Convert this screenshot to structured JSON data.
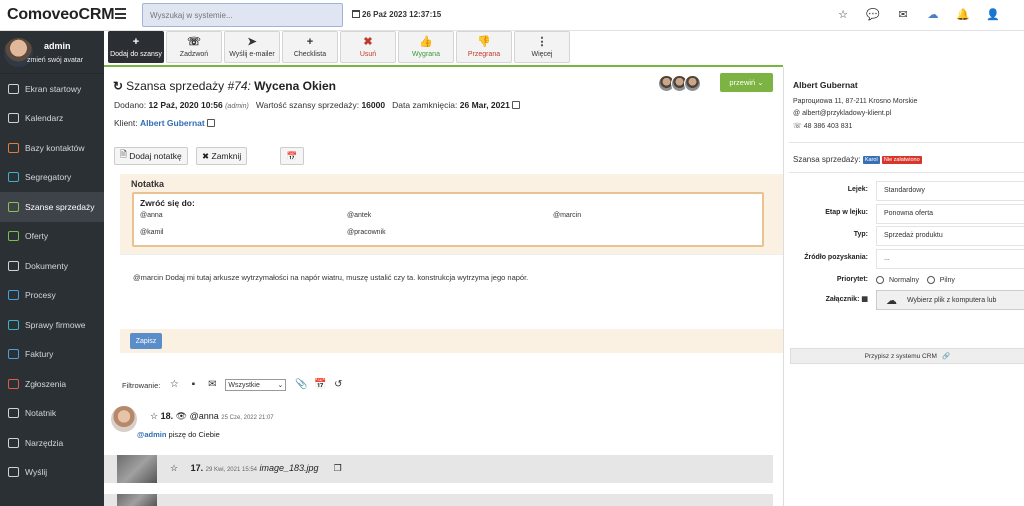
{
  "app": {
    "logo": "ComoveoCRM"
  },
  "header": {
    "search_placeholder": "Wyszukaj w systemie...",
    "datetime": "26 Paź 2023 12:37:15",
    "icons": [
      "star-icon",
      "chat-icon",
      "mail-icon",
      "cloud-icon",
      "bell-icon",
      "user-settings-icon"
    ]
  },
  "user": {
    "name": "admin",
    "change_avatar": "zmień swój avatar"
  },
  "sidebar": {
    "items": [
      {
        "label": "Ekran startowy",
        "icon": "monitor-icon",
        "color": "#cfd3d6"
      },
      {
        "label": "Kalendarz",
        "icon": "calendar-icon",
        "color": "#cfd3d6"
      },
      {
        "label": "Bazy kontaktów",
        "icon": "contacts-icon",
        "color": "#e87b3a"
      },
      {
        "label": "Segregatory",
        "icon": "folder-icon",
        "color": "#3fb0c9"
      },
      {
        "label": "Szanse sprzedaży",
        "icon": "refresh-icon",
        "color": "#8bc34a",
        "active": true
      },
      {
        "label": "Oferty",
        "icon": "offer-icon",
        "color": "#7bbf4b"
      },
      {
        "label": "Dokumenty",
        "icon": "document-icon",
        "color": "#cfd3d6"
      },
      {
        "label": "Procesy",
        "icon": "process-icon",
        "color": "#4a9fd8"
      },
      {
        "label": "Sprawy firmowe",
        "icon": "case-icon",
        "color": "#3fb0c9"
      },
      {
        "label": "Faktury",
        "icon": "invoice-icon",
        "color": "#4a9fd8"
      },
      {
        "label": "Zgłoszenia",
        "icon": "ticket-icon",
        "color": "#e05a47"
      },
      {
        "label": "Notatnik",
        "icon": "notebook-icon",
        "color": "#cfd3d6"
      },
      {
        "label": "Narzędzia",
        "icon": "tools-icon",
        "color": "#cfd3d6"
      },
      {
        "label": "Wyślij",
        "icon": "send-icon",
        "color": "#cfd3d6"
      }
    ]
  },
  "toolbar": [
    {
      "label": "Dodaj do szansy",
      "glyph": "+",
      "style": "primary",
      "icon": "plus-icon"
    },
    {
      "label": "Zadzwoń",
      "glyph": "☏",
      "style": "",
      "icon": "phone-icon"
    },
    {
      "label": "Wyślij e-mailer",
      "glyph": "➤",
      "style": "",
      "icon": "send-icon"
    },
    {
      "label": "Checklista",
      "glyph": "+",
      "style": "",
      "icon": "plus-icon"
    },
    {
      "label": "Usuń",
      "glyph": "✖",
      "style": "danger",
      "icon": "delete-icon"
    },
    {
      "label": "Wygrana",
      "glyph": "👍",
      "style": "success",
      "icon": "thumbs-up-icon"
    },
    {
      "label": "Przegrana",
      "glyph": "👎",
      "style": "danger",
      "icon": "thumbs-down-icon"
    },
    {
      "label": "Więcej",
      "glyph": "⋮",
      "style": "",
      "icon": "more-icon"
    }
  ],
  "deal": {
    "title_prefix": "Szansa sprzedaży",
    "number": "#74:",
    "name": "Wycena Okien",
    "move_button": "przewiń",
    "added_label": "Dodano:",
    "added_value": "12 Paź, 2020 10:56",
    "added_by": "(admin)",
    "value_label": "Wartość szansy sprzedaży:",
    "value": "16000",
    "close_label": "Data zamknięcia:",
    "close_value": "26 Mar, 2021",
    "client_label": "Klient:",
    "client_name": "Albert Gubernat",
    "add_note": "Dodaj notatkę",
    "close_button": "Zamknij"
  },
  "note": {
    "header": "Notatka",
    "mention_label": "Zwróć się do:",
    "mentions": [
      "@anna",
      "@antek",
      "@marcin",
      "@kamil",
      "@pracownik"
    ],
    "text": "@marcin Dodaj mi tutaj arkusze wytrzymałości na napór wiatru, muszę ustalić czy ta. konstrukcja wytrzyma jego napór.",
    "save": "Zapisz"
  },
  "filter": {
    "label": "Filtrowanie:",
    "select_value": "Wszystkie"
  },
  "feed": [
    {
      "number": "18.",
      "user": "@anna",
      "date": "25 Cze, 2022 21:07",
      "body_user": "@admin",
      "body_text": "piszę do Ciebie"
    },
    {
      "number": "17.",
      "date": "29 Kwi, 2021 15:54",
      "file": "image_183.jpg"
    }
  ],
  "client_panel": {
    "name": "Albert Gubernat",
    "address": "Paproциowa 11, 87-211 Krosno Morskie",
    "email": "albert@przykladowy-klient.pl",
    "phone": "48 386 403 831",
    "deal_label": "Szansa sprzedaży:",
    "badge1": "Karol",
    "badge2": "Nie załatwiono",
    "fields": [
      {
        "label": "Lejek:",
        "value": "Standardowy"
      },
      {
        "label": "Etap w lejku:",
        "value": "Ponowna oferta"
      },
      {
        "label": "Typ:",
        "value": "Sprzedaż produktu"
      },
      {
        "label": "Źródło pozyskania:",
        "value": "..."
      }
    ],
    "priority_label": "Priorytet:",
    "priority_normal": "Normalny",
    "priority_urgent": "Pilny",
    "attachment_label": "Załącznik:",
    "upload_label": "Wybierz plik z komputera  lub",
    "attach_system": "Przypisz z systemu CRM"
  }
}
